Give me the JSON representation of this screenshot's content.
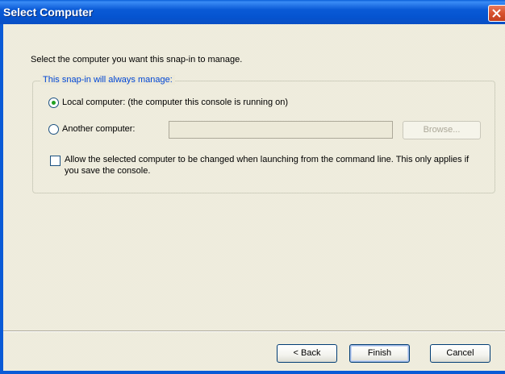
{
  "window": {
    "title": "Select Computer"
  },
  "prompt": "Select the computer you want this snap-in to manage.",
  "group": {
    "legend": "This snap-in will always manage:",
    "local_option": {
      "label": "Local computer:  (the computer this console is running on)",
      "selected": true
    },
    "another_option": {
      "label": "Another computer:",
      "selected": false
    },
    "computer_name_value": "",
    "browse_label": "Browse...",
    "allow_change": {
      "label": "Allow the selected computer to be changed when launching from the command line.  This only applies if you save the console.",
      "checked": false
    }
  },
  "buttons": {
    "back": "< Back",
    "finish": "Finish",
    "cancel": "Cancel"
  },
  "icons": {
    "close": "close-icon"
  },
  "colors": {
    "titlebar": "#0a5ad6",
    "legend_text": "#0046d5",
    "radio_dot": "#21a121"
  }
}
